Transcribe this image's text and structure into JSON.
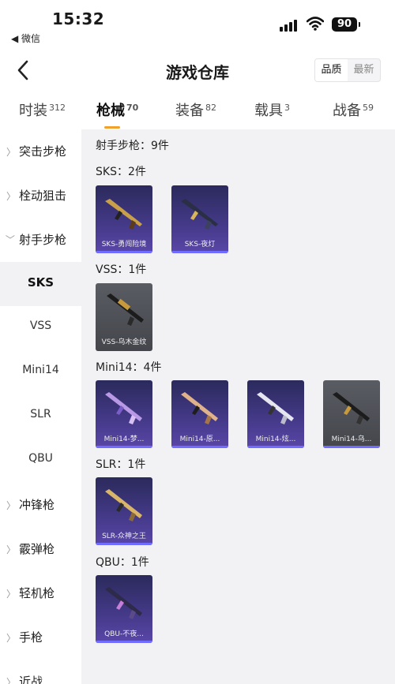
{
  "status": {
    "time": "15:32",
    "back_app": "◀ 微信",
    "battery": "90"
  },
  "header": {
    "title": "游戏仓库",
    "sort": [
      "品质",
      "最新"
    ]
  },
  "tabs": [
    {
      "label": "时装",
      "count": "312"
    },
    {
      "label": "枪械",
      "count": "70"
    },
    {
      "label": "装备",
      "count": "82"
    },
    {
      "label": "载具",
      "count": "3"
    },
    {
      "label": "战备",
      "count": "59"
    }
  ],
  "sidebar": {
    "items": [
      "突击步枪",
      "栓动狙击",
      "射手步枪",
      "SKS",
      "VSS",
      "Mini14",
      "SLR",
      "QBU",
      "冲锋枪",
      "霰弹枪",
      "轻机枪",
      "手枪",
      "近战"
    ]
  },
  "main": {
    "category_title": "射手步枪：9件",
    "groups": [
      {
        "title": "SKS：2件",
        "items": [
          "SKS-勇闯险境",
          "SKS-夜灯"
        ]
      },
      {
        "title": "VSS：1件",
        "items": [
          "VSS-乌木金纹"
        ]
      },
      {
        "title": "Mini14：4件",
        "items": [
          "Mini14-梦...",
          "Mini14-原...",
          "Mini14-炫...",
          "Mini14-乌..."
        ]
      },
      {
        "title": "SLR：1件",
        "items": [
          "SLR-众神之王"
        ]
      },
      {
        "title": "QBU：1件",
        "items": [
          "QBU-不夜..."
        ]
      }
    ]
  },
  "colors": {
    "accent": "#f0a12b",
    "rarity_bar": "#6f6cff",
    "card_purple": "#453a8a",
    "card_grey": "#4a4c52"
  }
}
